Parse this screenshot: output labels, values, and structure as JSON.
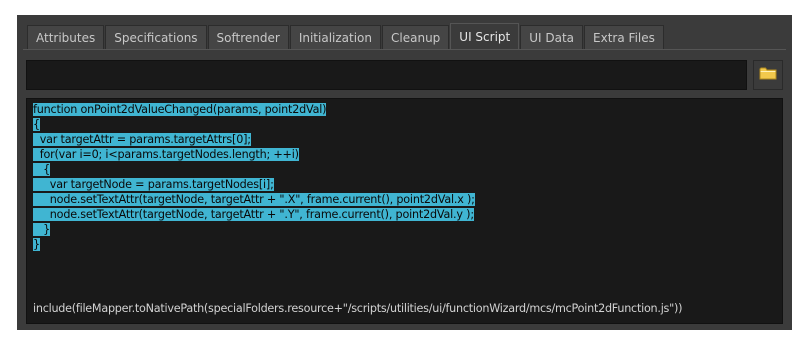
{
  "tabs": [
    {
      "label": "Attributes",
      "active": false
    },
    {
      "label": "Specifications",
      "active": false
    },
    {
      "label": "Softrender",
      "active": false
    },
    {
      "label": "Initialization",
      "active": false
    },
    {
      "label": "Cleanup",
      "active": false
    },
    {
      "label": "UI Script",
      "active": true
    },
    {
      "label": "UI Data",
      "active": false
    },
    {
      "label": "Extra Files",
      "active": false
    }
  ],
  "path_field": {
    "value": ""
  },
  "folder_button": {
    "icon": "folder-icon",
    "color": "#f2c94c"
  },
  "script": {
    "selected_lines": [
      "function onPoint2dValueChanged(params, point2dVal)",
      "{",
      "  var targetAttr = params.targetAttrs[0];",
      "  for(var i=0; i<params.targetNodes.length; ++i)",
      "   {",
      "     var targetNode = params.targetNodes[i];",
      "     node.setTextAttr(targetNode, targetAttr + \".X\", frame.current(), point2dVal.x );",
      "     node.setTextAttr(targetNode, targetAttr + \".Y\", frame.current(), point2dVal.y );",
      "   }",
      "}"
    ],
    "include_line": "include(fileMapper.toNativePath(specialFolders.resource+\"/scripts/utilities/ui/functionWizard/mcs/mcPoint2dFunction.js\"))",
    "selection_color": "#40b5d2"
  }
}
